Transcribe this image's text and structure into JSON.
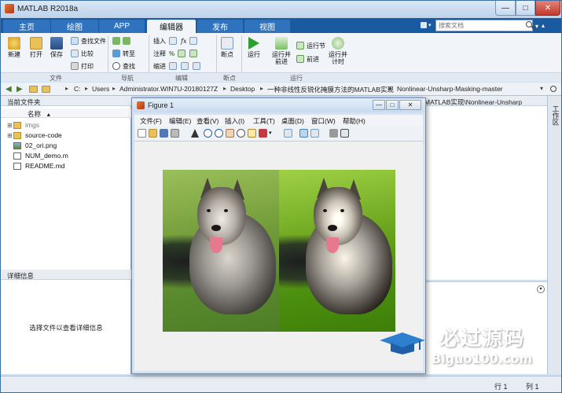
{
  "window": {
    "title": "MATLAB R2018a",
    "min": "—",
    "max": "□",
    "close": "✕"
  },
  "tabs": [
    {
      "label": "主页"
    },
    {
      "label": "绘图"
    },
    {
      "label": "APP"
    },
    {
      "label": "编辑器"
    },
    {
      "label": "发布"
    },
    {
      "label": "视图"
    }
  ],
  "search": {
    "placeholder": "搜索文档"
  },
  "ribbon": {
    "file": {
      "new": "新建",
      "open": "打开",
      "save": "保存",
      "find_files": "查找文件",
      "compare": "比较",
      "print": "打印",
      "section": "文件"
    },
    "nav": {
      "goto": "转至",
      "find": "查找",
      "section": "导航"
    },
    "edit": {
      "insert": "插入",
      "comment": "注释",
      "indent": "缩进",
      "fx": "fx",
      "section": "编辑"
    },
    "breakpoints": {
      "label": "断点",
      "section": "断点"
    },
    "run": {
      "run": "运行",
      "run_advance": "运行并前进",
      "run_section": "运行节",
      "advance": "前进",
      "run_time": "运行并计时",
      "section": "运行"
    }
  },
  "address": {
    "crumbs": [
      "C:",
      "Users",
      "Administrator.WIN7U-20180127Z",
      "Desktop",
      "一种非线性反锐化掩膜方法的MATLAB实现",
      "Nonlinear-Unsharp-Masking-master"
    ],
    "sep": "▸"
  },
  "left_panel": {
    "title": "当前文件夹",
    "col_name": "名称",
    "col_sort": "▲",
    "items": [
      {
        "name": "imgs",
        "type": "folder",
        "expand": "⊞"
      },
      {
        "name": "source-code",
        "type": "folder",
        "expand": "⊞"
      },
      {
        "name": "02_ori.png",
        "type": "image",
        "expand": ""
      },
      {
        "name": "NUM_demo.m",
        "type": "script",
        "expand": ""
      },
      {
        "name": "README.md",
        "type": "doc",
        "expand": ""
      }
    ],
    "details_title": "详细信息",
    "details_hint": "选择文件以查看详细信息"
  },
  "editor": {
    "header": "MATLAB实现\\Nonlinear-Unsharp",
    "workspace_label": "工作区"
  },
  "figure": {
    "title": "Figure 1",
    "menu": [
      "文件(F)",
      "编辑(E)",
      "查看(V)",
      "插入(I)",
      "工具(T)",
      "桌面(D)",
      "窗口(W)",
      "帮助(H)"
    ]
  },
  "status": {
    "row": "行 1",
    "col": "列 1"
  },
  "watermark": {
    "brand": "必过源码",
    "url": "Biguo100.com"
  },
  "colors": {
    "accent": "#1a5aa0",
    "tab_active": "#f1f4f8",
    "close": "#c4392b"
  }
}
